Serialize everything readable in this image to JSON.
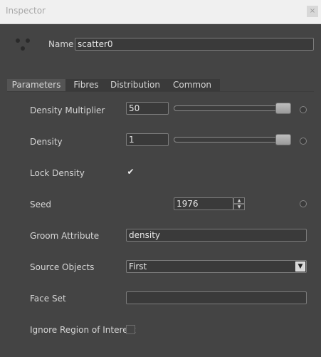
{
  "window": {
    "title": "Inspector",
    "close_icon": "close-icon"
  },
  "node": {
    "icon": "scatter-node-icon",
    "name_label": "Name",
    "name_value": "scatter0"
  },
  "tabs": [
    {
      "label": "Parameters",
      "active": true
    },
    {
      "label": "Fibres",
      "active": false
    },
    {
      "label": "Distribution",
      "active": false
    },
    {
      "label": "Common",
      "active": false
    }
  ],
  "params": {
    "density_multiplier": {
      "label": "Density Multiplier",
      "value": "50",
      "slider_fraction": 1.0
    },
    "density": {
      "label": "Density",
      "value": "1",
      "slider_fraction": 1.0
    },
    "lock_density": {
      "label": "Lock Density",
      "checked": true,
      "check_glyph": "✔"
    },
    "seed": {
      "label": "Seed",
      "value": "1976"
    },
    "groom_attribute": {
      "label": "Groom Attribute",
      "value": "density"
    },
    "source_objects": {
      "label": "Source Objects",
      "selected": "First"
    },
    "face_set": {
      "label": "Face Set",
      "value": ""
    },
    "ignore_roi": {
      "label": "Ignore Region of Interest",
      "checked": false
    }
  },
  "colors": {
    "panel_bg": "#444444",
    "titlebar_bg": "#f0f0f0",
    "active_tab_bg": "#545454",
    "text": "#d6d6d6"
  }
}
